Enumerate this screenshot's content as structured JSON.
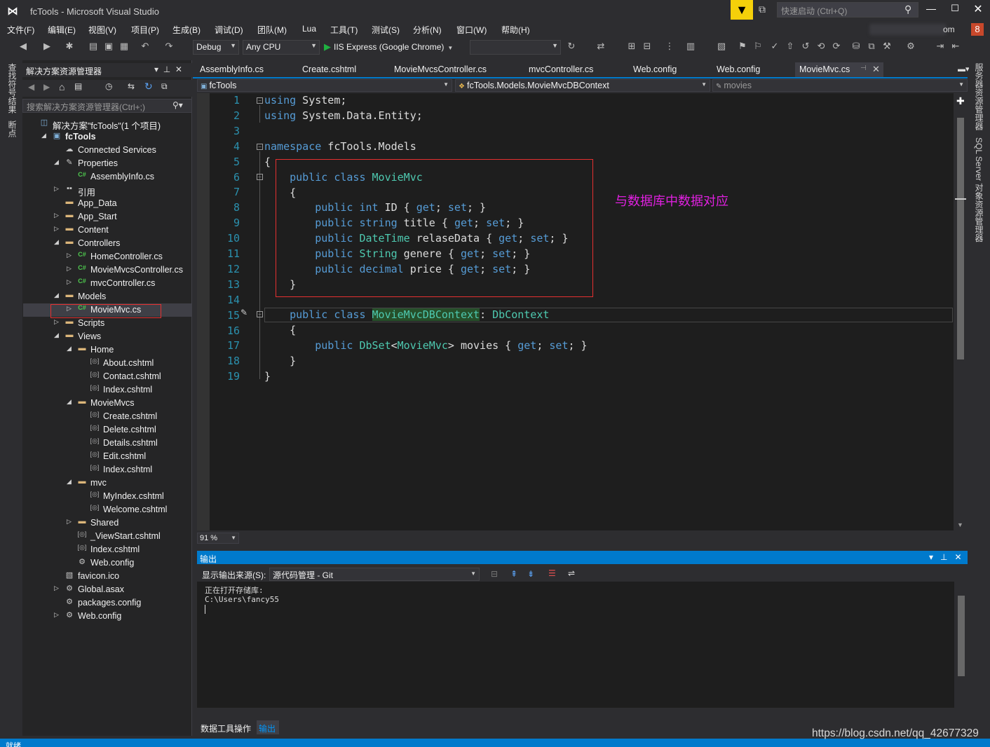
{
  "window": {
    "title": "fcTools - Microsoft Visual Studio",
    "quick_launch_placeholder": "快速启动 (Ctrl+Q)",
    "account_tail": "om",
    "notification_count": "8"
  },
  "menu": [
    "文件(F)",
    "编辑(E)",
    "视图(V)",
    "项目(P)",
    "生成(B)",
    "调试(D)",
    "团队(M)",
    "Lua",
    "工具(T)",
    "测试(S)",
    "分析(N)",
    "窗口(W)",
    "帮助(H)"
  ],
  "toolbar": {
    "configuration": "Debug",
    "platform": "Any CPU",
    "run_target": "IIS Express (Google Chrome)"
  },
  "left_strip_tabs": [
    "查找符号结果",
    "断点"
  ],
  "right_strip_tabs": [
    "服务器资源管理器",
    "SQL Server 对象资源管理器"
  ],
  "solution_explorer": {
    "title": "解决方案资源管理器",
    "search_placeholder": "搜索解决方案资源管理器(Ctrl+;)",
    "items": [
      {
        "label": "解决方案\"fcTools\"(1 个项目)",
        "indent": 0,
        "exp": "",
        "icon": "solution"
      },
      {
        "label": "fcTools",
        "indent": 1,
        "exp": "◢",
        "icon": "project"
      },
      {
        "label": "Connected Services",
        "indent": 2,
        "exp": "",
        "icon": "cloud"
      },
      {
        "label": "Properties",
        "indent": 2,
        "exp": "◢",
        "icon": "wrench"
      },
      {
        "label": "AssemblyInfo.cs",
        "indent": 3,
        "exp": "",
        "icon": "cs"
      },
      {
        "label": "引用",
        "indent": 2,
        "exp": "▷",
        "icon": "refs"
      },
      {
        "label": "App_Data",
        "indent": 2,
        "exp": "",
        "icon": "folder"
      },
      {
        "label": "App_Start",
        "indent": 2,
        "exp": "▷",
        "icon": "folder"
      },
      {
        "label": "Content",
        "indent": 2,
        "exp": "▷",
        "icon": "folder"
      },
      {
        "label": "Controllers",
        "indent": 2,
        "exp": "◢",
        "icon": "folder"
      },
      {
        "label": "HomeController.cs",
        "indent": 3,
        "exp": "▷",
        "icon": "cs"
      },
      {
        "label": "MovieMvcsController.cs",
        "indent": 3,
        "exp": "▷",
        "icon": "cs"
      },
      {
        "label": "mvcController.cs",
        "indent": 3,
        "exp": "▷",
        "icon": "cs"
      },
      {
        "label": "Models",
        "indent": 2,
        "exp": "◢",
        "icon": "folder"
      },
      {
        "label": "MovieMvc.cs",
        "indent": 3,
        "exp": "▷",
        "icon": "cs"
      },
      {
        "label": "Scripts",
        "indent": 2,
        "exp": "▷",
        "icon": "folder"
      },
      {
        "label": "Views",
        "indent": 2,
        "exp": "◢",
        "icon": "folder"
      },
      {
        "label": "Home",
        "indent": 3,
        "exp": "◢",
        "icon": "folder"
      },
      {
        "label": "About.cshtml",
        "indent": 4,
        "exp": "",
        "icon": "file"
      },
      {
        "label": "Contact.cshtml",
        "indent": 4,
        "exp": "",
        "icon": "file"
      },
      {
        "label": "Index.cshtml",
        "indent": 4,
        "exp": "",
        "icon": "file"
      },
      {
        "label": "MovieMvcs",
        "indent": 3,
        "exp": "◢",
        "icon": "folder"
      },
      {
        "label": "Create.cshtml",
        "indent": 4,
        "exp": "",
        "icon": "file"
      },
      {
        "label": "Delete.cshtml",
        "indent": 4,
        "exp": "",
        "icon": "file"
      },
      {
        "label": "Details.cshtml",
        "indent": 4,
        "exp": "",
        "icon": "file"
      },
      {
        "label": "Edit.cshtml",
        "indent": 4,
        "exp": "",
        "icon": "file"
      },
      {
        "label": "Index.cshtml",
        "indent": 4,
        "exp": "",
        "icon": "file"
      },
      {
        "label": "mvc",
        "indent": 3,
        "exp": "◢",
        "icon": "folder"
      },
      {
        "label": "MyIndex.cshtml",
        "indent": 4,
        "exp": "",
        "icon": "file"
      },
      {
        "label": "Welcome.cshtml",
        "indent": 4,
        "exp": "",
        "icon": "file"
      },
      {
        "label": "Shared",
        "indent": 3,
        "exp": "▷",
        "icon": "folder"
      },
      {
        "label": "_ViewStart.cshtml",
        "indent": 3,
        "exp": "",
        "icon": "file"
      },
      {
        "label": "Index.cshtml",
        "indent": 3,
        "exp": "",
        "icon": "file"
      },
      {
        "label": "Web.config",
        "indent": 3,
        "exp": "",
        "icon": "config"
      },
      {
        "label": "favicon.ico",
        "indent": 2,
        "exp": "",
        "icon": "image"
      },
      {
        "label": "Global.asax",
        "indent": 2,
        "exp": "▷",
        "icon": "config"
      },
      {
        "label": "packages.config",
        "indent": 2,
        "exp": "",
        "icon": "config"
      },
      {
        "label": "Web.config",
        "indent": 2,
        "exp": "▷",
        "icon": "config"
      }
    ],
    "selected_index": 14
  },
  "editor": {
    "tabs": [
      "AssemblyInfo.cs",
      "Create.cshtml",
      "MovieMvcsController.cs",
      "mvcController.cs",
      "Web.config",
      "Web.config",
      "MovieMvc.cs"
    ],
    "active_tab": "MovieMvc.cs",
    "nav_project": "fcTools",
    "nav_type": "fcTools.Models.MovieMvcDBContext",
    "nav_member": "movies",
    "zoom": "91 %",
    "line_numbers": [
      "1",
      "2",
      "3",
      "4",
      "5",
      "6",
      "7",
      "8",
      "9",
      "10",
      "11",
      "12",
      "13",
      "14",
      "15",
      "16",
      "17",
      "18",
      "19"
    ],
    "annotation": "与数据库中数据对应"
  },
  "output": {
    "title": "输出",
    "source_label": "显示输出来源(S):",
    "source_value": "源代码管理 - Git",
    "lines": [
      "正在打开存储库:",
      "C:\\Users\\fancy55"
    ]
  },
  "bottom_tabs": [
    "数据工具操作",
    "输出"
  ],
  "status": {
    "text": "就绪"
  },
  "watermark": "https://blog.csdn.net/qq_42677329"
}
